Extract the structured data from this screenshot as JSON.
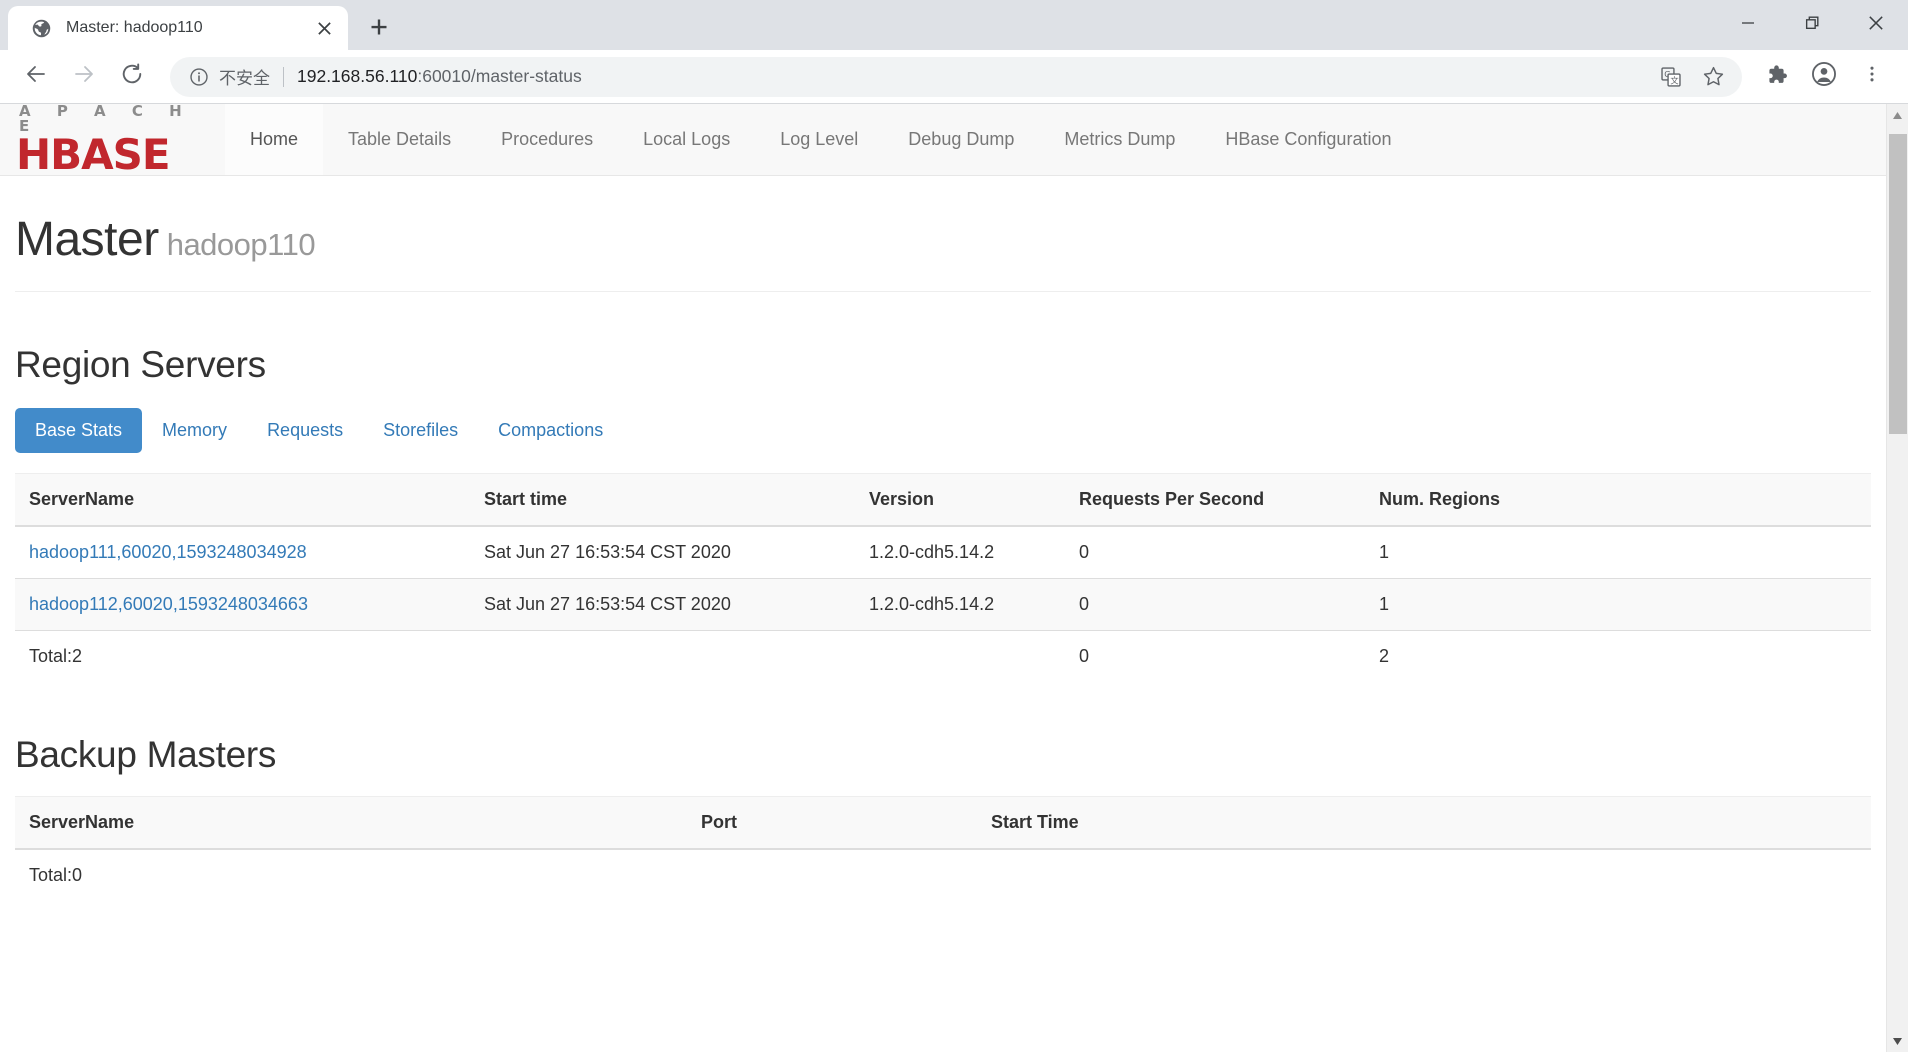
{
  "browser": {
    "tab": {
      "title": "Master: hadoop110",
      "favicon_icon": "globe-icon",
      "close_icon": "close-icon"
    },
    "new_tab_icon": "plus-icon",
    "window_controls": {
      "minimize_icon": "minimize-icon",
      "restore_icon": "restore-icon",
      "close_icon": "close-icon"
    },
    "toolbar": {
      "back_icon": "back-arrow-icon",
      "forward_icon": "forward-arrow-icon",
      "reload_icon": "reload-icon",
      "info_icon": "info-circle-icon",
      "security_label": "不安全",
      "url_host": "192.168.56.110",
      "url_path": ":60010/master-status",
      "translate_icon": "translate-icon",
      "bookmark_icon": "star-icon",
      "extensions_icon": "puzzle-icon",
      "profile_icon": "account-circle-icon",
      "menu_icon": "three-dot-menu-icon"
    },
    "scrollbar": {
      "up_icon": "scroll-up-arrow-icon",
      "down_icon": "scroll-down-arrow-icon"
    }
  },
  "site": {
    "brand": {
      "apache": "A P A C H E",
      "hbase": "HBASE"
    },
    "nav": [
      {
        "label": "Home",
        "active": true
      },
      {
        "label": "Table Details",
        "active": false
      },
      {
        "label": "Procedures",
        "active": false
      },
      {
        "label": "Local Logs",
        "active": false
      },
      {
        "label": "Log Level",
        "active": false
      },
      {
        "label": "Debug Dump",
        "active": false
      },
      {
        "label": "Metrics Dump",
        "active": false
      },
      {
        "label": "HBase Configuration",
        "active": false
      }
    ],
    "header": {
      "title": "Master",
      "subtitle": "hadoop110"
    },
    "region_servers": {
      "heading": "Region Servers",
      "tabs": [
        {
          "label": "Base Stats",
          "active": true
        },
        {
          "label": "Memory",
          "active": false
        },
        {
          "label": "Requests",
          "active": false
        },
        {
          "label": "Storefiles",
          "active": false
        },
        {
          "label": "Compactions",
          "active": false
        }
      ],
      "columns": [
        "ServerName",
        "Start time",
        "Version",
        "Requests Per Second",
        "Num. Regions"
      ],
      "rows": [
        {
          "server_name": "hadoop111,60020,1593248034928",
          "start_time": "Sat Jun 27 16:53:54 CST 2020",
          "version": "1.2.0-cdh5.14.2",
          "requests_per_second": "0",
          "num_regions": "1"
        },
        {
          "server_name": "hadoop112,60020,1593248034663",
          "start_time": "Sat Jun 27 16:53:54 CST 2020",
          "version": "1.2.0-cdh5.14.2",
          "requests_per_second": "0",
          "num_regions": "1"
        }
      ],
      "total": {
        "label": "Total:2",
        "start_time": "",
        "version": "",
        "requests_per_second": "0",
        "num_regions": "2"
      }
    },
    "backup_masters": {
      "heading": "Backup Masters",
      "columns": [
        "ServerName",
        "Port",
        "Start Time"
      ],
      "rows": [],
      "total": {
        "label": "Total:0",
        "port": "",
        "start_time": ""
      }
    }
  },
  "colors": {
    "brand_red": "#c1272d",
    "link_blue": "#337ab7",
    "tab_active_blue": "#428bca",
    "chrome_tabstrip": "#dee1e6",
    "omnibox_bg": "#f1f3f4"
  }
}
